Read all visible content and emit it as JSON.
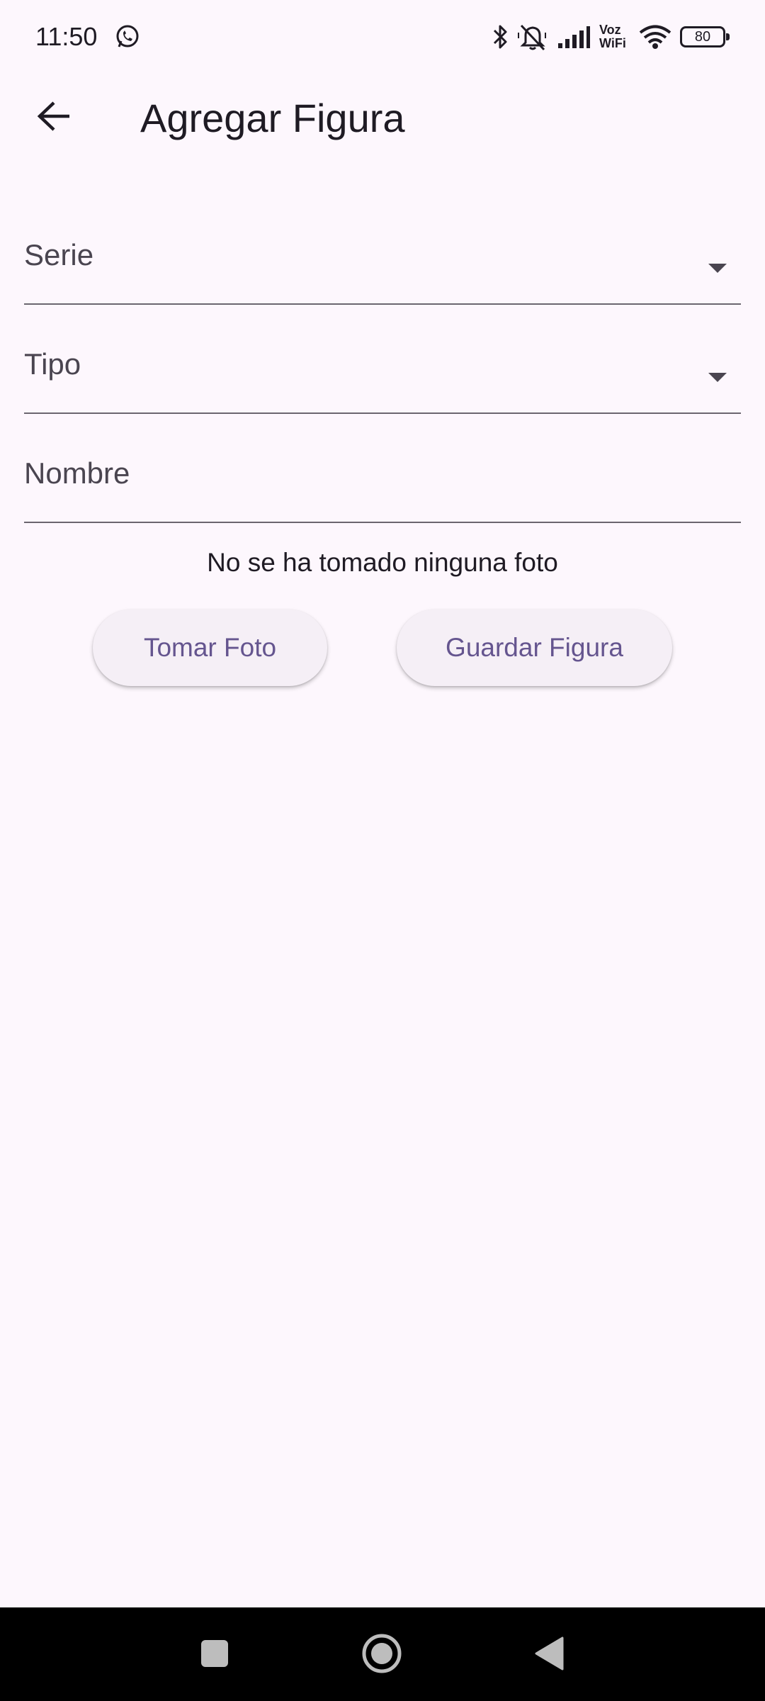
{
  "status_bar": {
    "time": "11:50",
    "voz_label": "Voz",
    "wifi_label": "WiFi",
    "battery": "80",
    "icons": [
      "whatsapp-icon",
      "bluetooth-icon",
      "silent-bell-icon",
      "signal-icon",
      "wifi-icon",
      "battery-icon"
    ]
  },
  "app_bar": {
    "title": "Agregar Figura",
    "back_icon": "arrow-back-icon"
  },
  "form": {
    "serie_label": "Serie",
    "tipo_label": "Tipo",
    "nombre_label": "Nombre"
  },
  "photo_status": "No se ha tomado ninguna foto",
  "buttons": {
    "take_photo": "Tomar Foto",
    "save_figure": "Guardar Figura"
  },
  "colors": {
    "background": "#fdf7fd",
    "accent": "#65558f",
    "button_bg": "#f5eff6"
  },
  "nav_bar": {
    "icons": [
      "recents-icon",
      "home-icon",
      "back-icon"
    ]
  }
}
